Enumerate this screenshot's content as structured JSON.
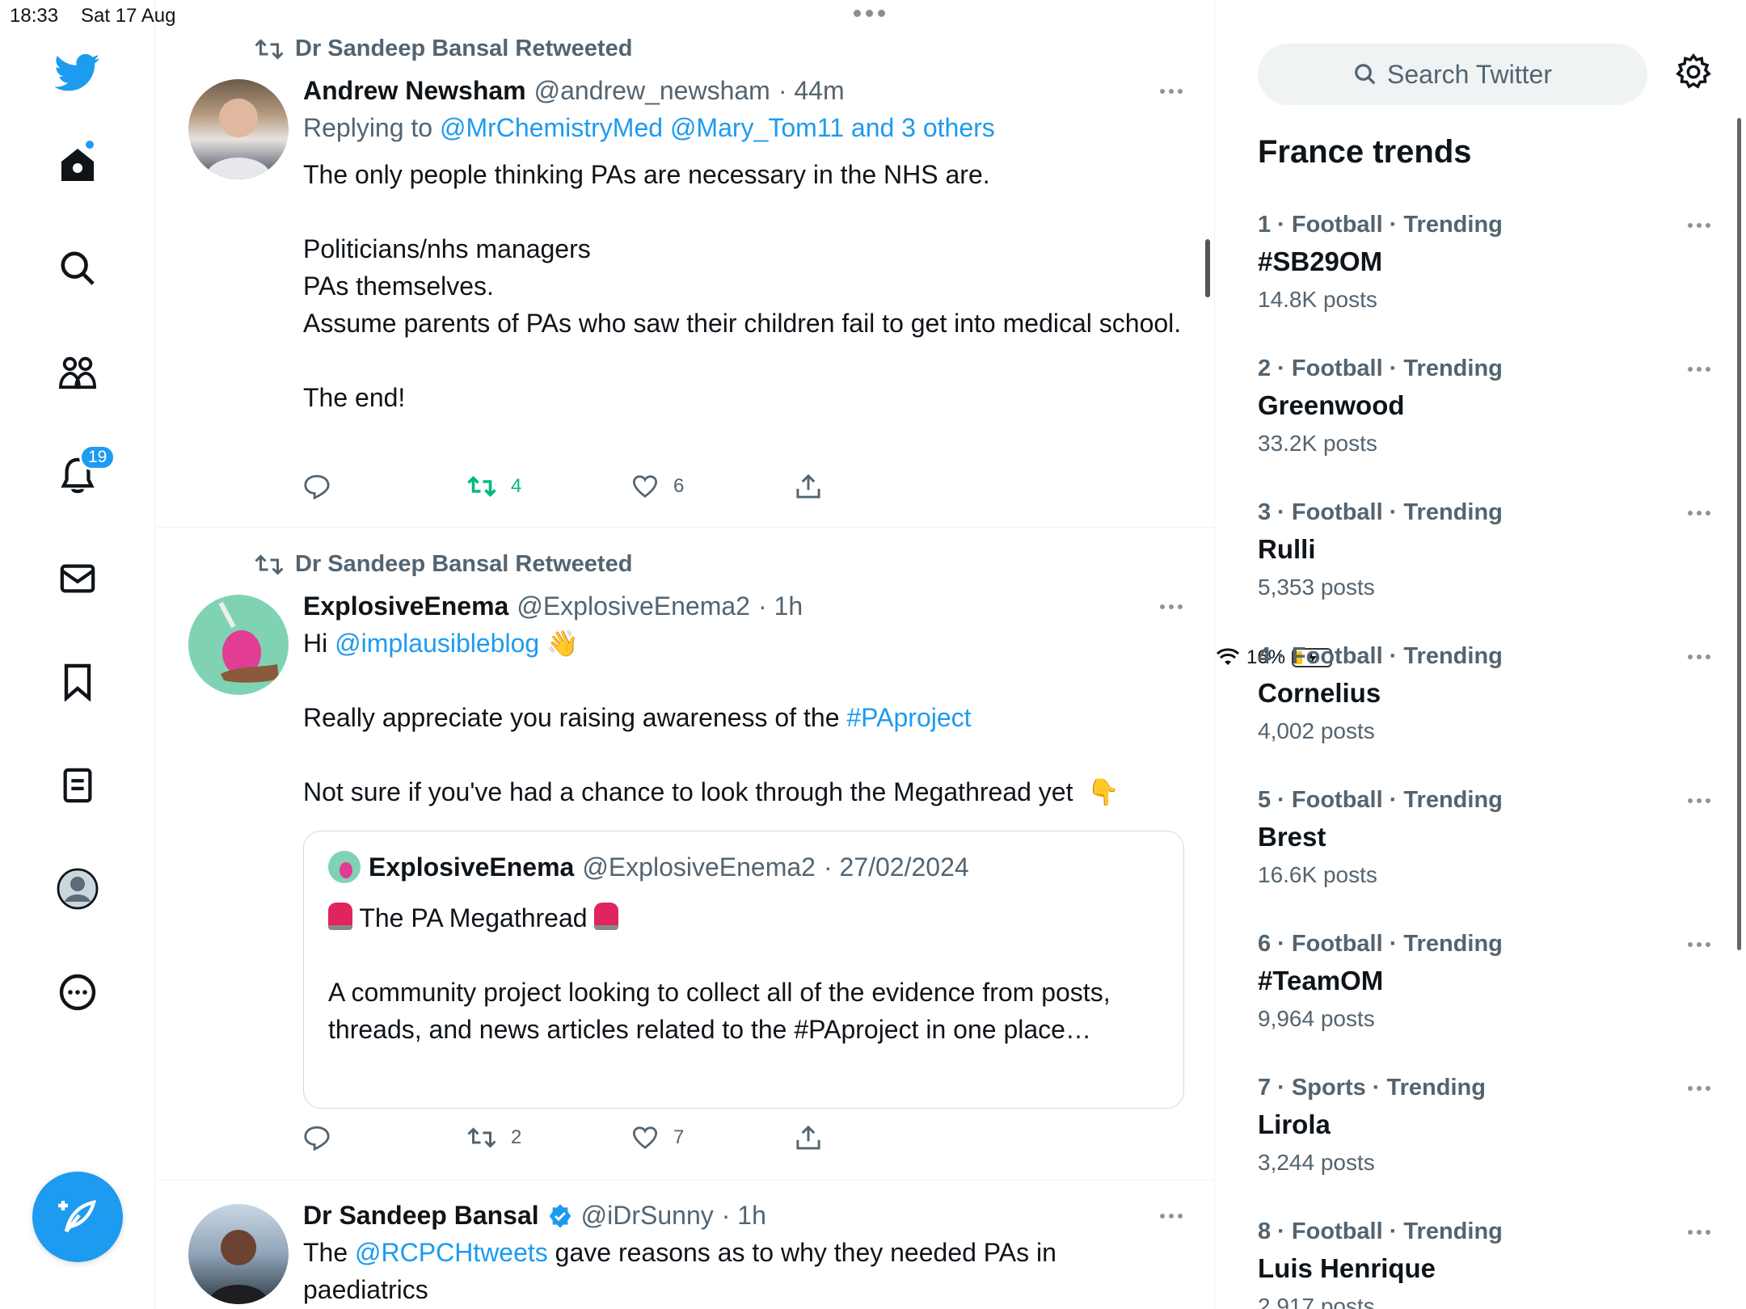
{
  "status_bar": {
    "time": "18:33",
    "date": "Sat 17 Aug",
    "battery": "16%"
  },
  "rail": {
    "notifications_badge": "19"
  },
  "tweets": [
    {
      "retweeted_by": "Dr Sandeep Bansal Retweeted",
      "name": "Andrew Newsham",
      "handle": "@andrew_newsham",
      "time": "· 44m",
      "replying_prefix": "Replying to ",
      "replying_to": "@MrChemistryMed @Mary_Tom11 and 3 others",
      "text": "The only people thinking PAs are necessary in the NHS are.\n\nPoliticians/nhs managers\nPAs themselves.\nAssume parents of PAs who saw their children fail to get into medical school.\n\nThe end!",
      "retweets": "4",
      "likes": "6"
    },
    {
      "retweeted_by": "Dr Sandeep Bansal Retweeted",
      "name": "ExplosiveEnema",
      "handle": "@ExplosiveEnema2",
      "time": "· 1h",
      "line1_prefix": "Hi ",
      "line1_link": "@implausibleblog",
      "line2_prefix": "Really appreciate you raising awareness of the ",
      "line2_link": "#PAproject",
      "line3": "Not sure if you've had a chance to look through the Megathread yet",
      "quote": {
        "name": "ExplosiveEnema",
        "handle": "@ExplosiveEnema2",
        "time": "· 27/02/2024",
        "title": " The PA Megathread ",
        "text": "A community project looking to collect all of the evidence from posts, threads, and news articles related to the #PAproject in one place…"
      },
      "retweets": "2",
      "likes": "7"
    },
    {
      "name": "Dr Sandeep Bansal",
      "handle": "@iDrSunny",
      "time": "· 1h",
      "prefix": "The ",
      "link": "@RCPCHtweets",
      "suffix": " gave reasons as to why they needed PAs in paediatrics"
    }
  ],
  "sidebar": {
    "search_placeholder": "Search Twitter",
    "trends_title": "France trends",
    "trends": [
      {
        "category": "1 · Football · Trending",
        "name": "#SB29OM",
        "count": "14.8K posts"
      },
      {
        "category": "2 · Football · Trending",
        "name": "Greenwood",
        "count": "33.2K posts"
      },
      {
        "category": "3 · Football · Trending",
        "name": "Rulli",
        "count": "5,353 posts"
      },
      {
        "category": "4 · Football · Trending",
        "name": "Cornelius",
        "count": "4,002 posts"
      },
      {
        "category": "5 · Football · Trending",
        "name": "Brest",
        "count": "16.6K posts"
      },
      {
        "category": "6 · Football · Trending",
        "name": "#TeamOM",
        "count": "9,964 posts"
      },
      {
        "category": "7 · Sports · Trending",
        "name": "Lirola",
        "count": "3,244 posts"
      },
      {
        "category": "8 · Football · Trending",
        "name": "Luis Henrique",
        "count": "2,917 posts"
      }
    ]
  },
  "colors": {
    "accent": "#1d9bf0",
    "retweet_active": "#00ba7c",
    "muted": "#536471"
  },
  "icons": [
    "twitter-bird-icon",
    "home-icon",
    "search-icon",
    "communities-icon",
    "bell-icon",
    "mail-icon",
    "bookmark-icon",
    "lists-icon",
    "profile-icon",
    "more-circle-icon",
    "compose-icon",
    "retweet-icon",
    "reply-icon",
    "like-icon",
    "share-icon",
    "verified-icon",
    "gear-icon",
    "wifi-icon",
    "battery-icon"
  ]
}
